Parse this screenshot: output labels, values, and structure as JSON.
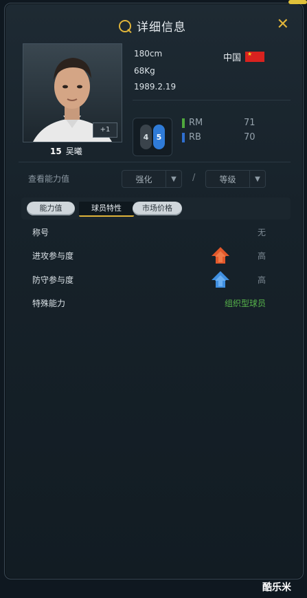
{
  "header": {
    "title": "详细信息",
    "close_label": "✕"
  },
  "player": {
    "number": "15",
    "name": "吴曦",
    "badge": "+1",
    "height": "180cm",
    "weight": "68Kg",
    "birthday": "1989.2.19",
    "nation": "中国"
  },
  "feet": {
    "left": "4",
    "right": "5"
  },
  "positions": [
    {
      "code": "RM",
      "value": "71",
      "color": "#4fa83d"
    },
    {
      "code": "RB",
      "value": "70",
      "color": "#2f6fd0"
    }
  ],
  "ability": {
    "label": "查看能力值",
    "enhance_select": "强化",
    "level_select": "等级",
    "separator": "/"
  },
  "tabs": [
    {
      "label": "能力值",
      "active": false
    },
    {
      "label": "球员特性",
      "active": true
    },
    {
      "label": "市场价格",
      "active": false
    }
  ],
  "traits": [
    {
      "label": "称号",
      "value": "无",
      "arrow": null
    },
    {
      "label": "进攻参与度",
      "value": "高",
      "arrow": "up-orange"
    },
    {
      "label": "防守参与度",
      "value": "高",
      "arrow": "up-blue"
    },
    {
      "label": "特殊能力",
      "value": "组织型球员",
      "arrow": null,
      "highlight": true
    }
  ],
  "watermark": "酷乐米",
  "colors": {
    "accent": "#e1b53a",
    "orange_arrow": "#e2582b",
    "blue_arrow": "#3f8fe0",
    "green_value": "#57b34a"
  }
}
